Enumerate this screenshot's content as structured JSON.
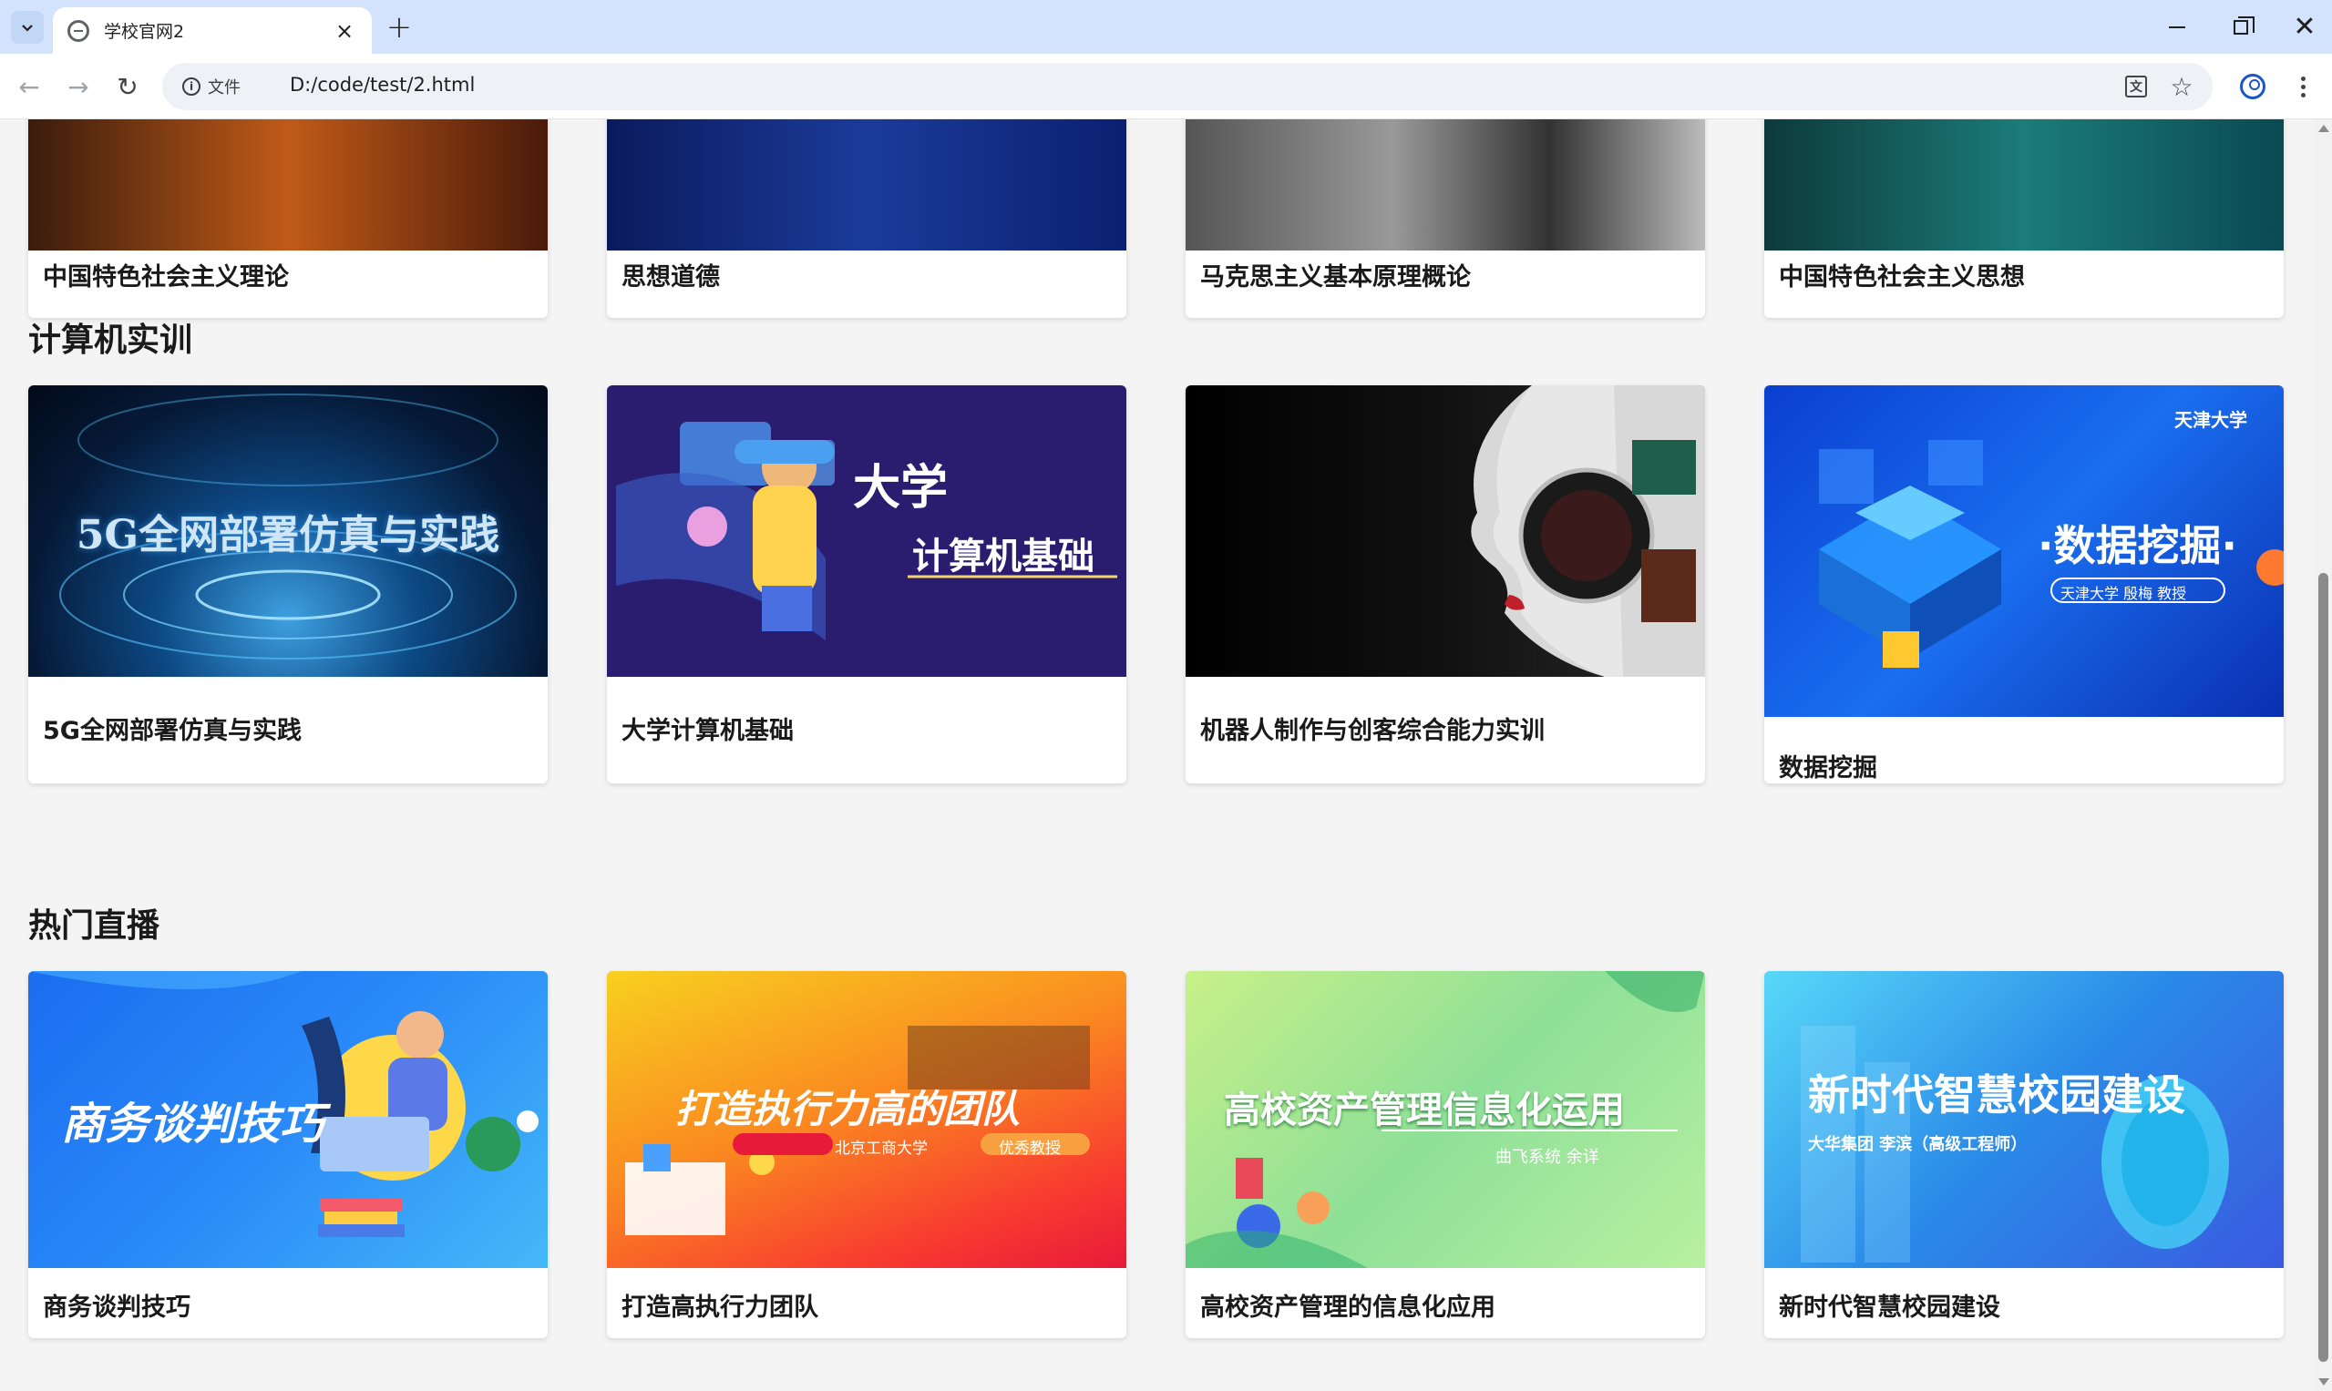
{
  "browser": {
    "tab_title": "学校官网2",
    "new_tab": "+",
    "close": "×",
    "site_info_label": "文件",
    "url": "D:/code/test/2.html",
    "translate_glyph": "文",
    "star": "☆"
  },
  "sections": {
    "top_row": [
      {
        "title": "中国特色社会主义理论"
      },
      {
        "title": "思想道德"
      },
      {
        "title": "马克思主义基本原理概论"
      },
      {
        "title": "中国特色社会主义思想"
      }
    ],
    "computer": {
      "heading": "计算机实训",
      "cards": [
        {
          "title": "5G全网部署仿真与实践",
          "img_text": "5G全网部署仿真与实践"
        },
        {
          "title": "大学计算机基础",
          "img_text_1": "大学",
          "img_text_2": "计算机基础"
        },
        {
          "title": "机器人制作与创客综合能力实训"
        },
        {
          "title": "数据挖掘",
          "img_text": "·数据挖掘·",
          "img_sub": "天津大学 殷梅 教授",
          "img_logo": "天津大学"
        }
      ]
    },
    "live": {
      "heading": "热门直播",
      "cards": [
        {
          "title": "商务谈判技巧",
          "img_text": "商务谈判技巧"
        },
        {
          "title": "打造高执行力团队",
          "img_text": "打造执行力高的团队",
          "img_sub_1": "北京工商大学",
          "img_sub_2": "优秀教授"
        },
        {
          "title": "高校资产管理的信息化应用",
          "img_text": "高校资产管理信息化运用",
          "img_sub": "曲飞系统 余详"
        },
        {
          "title": "新时代智慧校园建设",
          "img_text": "新时代智慧校园建设",
          "img_sub": "大华集团 李滨（高级工程师）"
        }
      ]
    }
  },
  "colors": {
    "page_bg": "#f4f4f4",
    "tabbar_bg": "#d3e3fd",
    "card_bg": "#ffffff"
  }
}
